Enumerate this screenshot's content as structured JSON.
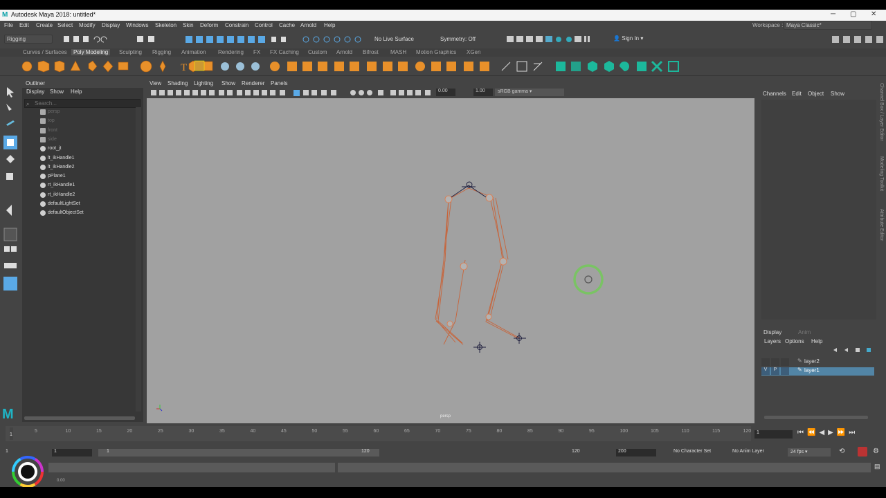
{
  "window": {
    "title": "Autodesk Maya 2018: untitled*"
  },
  "menubar": [
    "File",
    "Edit",
    "Create",
    "Select",
    "Modify",
    "Display",
    "Windows",
    "Skeleton",
    "Skin",
    "Deform",
    "Constrain",
    "Control",
    "Cache",
    "Arnold",
    "Help"
  ],
  "workspace": {
    "label": "Workspace :",
    "value": "Maya Classic*"
  },
  "statusline": {
    "mode": "Rigging",
    "live_surface": "No Live Surface",
    "symmetry": "Symmetry: Off",
    "sign_in": "Sign In"
  },
  "shelf_tabs": [
    "Curves / Surfaces",
    "Poly Modeling",
    "Sculpting",
    "Rigging",
    "Animation",
    "Rendering",
    "FX",
    "FX Caching",
    "Custom",
    "Arnold",
    "Bifrost",
    "MASH",
    "Motion Graphics",
    "XGen"
  ],
  "shelf_active": "Poly Modeling",
  "outliner": {
    "title": "Outliner",
    "menu": [
      "Display",
      "Show",
      "Help"
    ],
    "search_placeholder": "Search...",
    "items": [
      {
        "label": "persp",
        "dim": true
      },
      {
        "label": "top",
        "dim": true
      },
      {
        "label": "front",
        "dim": true
      },
      {
        "label": "side",
        "dim": true
      },
      {
        "label": "root_jt",
        "dim": false
      },
      {
        "label": "lt_ikHandle1",
        "dim": false
      },
      {
        "label": "lt_ikHandle2",
        "dim": false
      },
      {
        "label": "pPlane1",
        "dim": false
      },
      {
        "label": "rt_ikHandle1",
        "dim": false
      },
      {
        "label": "rt_ikHandle2",
        "dim": false
      },
      {
        "label": "defaultLightSet",
        "dim": false
      },
      {
        "label": "defaultObjectSet",
        "dim": false
      }
    ]
  },
  "viewport": {
    "menu": [
      "View",
      "Shading",
      "Lighting",
      "Show",
      "Renderer",
      "Panels"
    ],
    "exposure": "0.00",
    "gamma": "1.00",
    "colorspace": "sRGB gamma",
    "camera_label": "persp"
  },
  "channel_box": {
    "menu": [
      "Channels",
      "Edit",
      "Object",
      "Show"
    ]
  },
  "side_tabs": [
    "Channel Box / Layer Editor",
    "Modeling Toolkit",
    "Attribute Editor"
  ],
  "layer_editor": {
    "tabs": [
      "Display",
      "Anim"
    ],
    "menu": [
      "Layers",
      "Options",
      "Help"
    ],
    "layers": [
      {
        "name": "layer2",
        "selected": false,
        "v": "",
        "p": ""
      },
      {
        "name": "layer1",
        "selected": true,
        "v": "V",
        "p": "P"
      }
    ]
  },
  "timeline": {
    "ticks": [
      "5",
      "10",
      "15",
      "20",
      "25",
      "30",
      "35",
      "40",
      "45",
      "50",
      "55",
      "60",
      "65",
      "70",
      "75",
      "80",
      "85",
      "90",
      "95",
      "100",
      "105",
      "110",
      "115",
      "120"
    ],
    "current_frame": "1",
    "first_tick": "1"
  },
  "range": {
    "start": "1",
    "playback_start": "1",
    "slider_start": "1",
    "slider_end": "120",
    "playback_end": "120",
    "end": "200",
    "character_set": "No Character Set",
    "anim_layer": "No Anim Layer",
    "fps": "24 fps"
  },
  "cmdline": {
    "label": "0.00"
  }
}
